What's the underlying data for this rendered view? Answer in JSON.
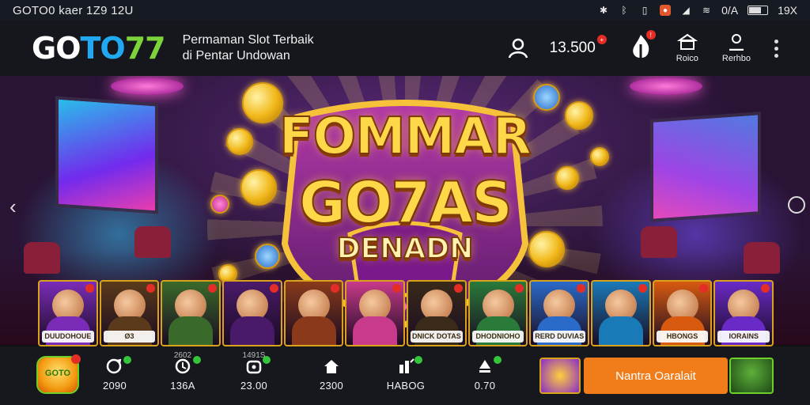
{
  "status_bar": {
    "left_text": "GOTO0 kaer 1Z9  12U",
    "right_text": "0/A",
    "right_time": "19X"
  },
  "header": {
    "logo": {
      "part1": "GO",
      "part2": "TO",
      "part3": "77"
    },
    "tagline_line1": "Permaman Slot Terbaik",
    "tagline_line2": "di Pentar Undowan",
    "balance": "13.500",
    "icon1_label": "Roico",
    "icon2_label": "Rerhbo"
  },
  "banner": {
    "title_line1": "FOMMAR",
    "title_line2": "GO7AS",
    "title_line3": "DENADN"
  },
  "games": [
    {
      "label": "DUUDOHOUE",
      "color": "#7a2cb8"
    },
    {
      "label": "Ø3",
      "color": "#5a3a1a"
    },
    {
      "label": "",
      "color": "#3a6a2a"
    },
    {
      "label": "",
      "color": "#4a1a6a"
    },
    {
      "label": "",
      "color": "#8a3a1a"
    },
    {
      "label": "",
      "color": "#c83a8a"
    },
    {
      "label": "DNICK DOTAS",
      "color": "#3a2a1a"
    },
    {
      "label": "DHODNIOHO",
      "color": "#2a7a3a"
    },
    {
      "label": "RERD DUVIAS",
      "color": "#2a6ac8"
    },
    {
      "label": "",
      "color": "#1a7ab8"
    },
    {
      "label": "HBONGS",
      "color": "#d85a10"
    },
    {
      "label": "IORAINS",
      "color": "#6a2ac8"
    }
  ],
  "bottom_nav": {
    "logo_text": "GOTO",
    "items": [
      {
        "top": "",
        "value": "2090",
        "icon": "refresh-icon"
      },
      {
        "top": "2602",
        "value": "136A",
        "icon": "history-icon"
      },
      {
        "top": "1491S",
        "value": "23.00",
        "icon": "wallet-icon"
      },
      {
        "top": "",
        "value": "2300",
        "icon": "home-icon"
      },
      {
        "top": "",
        "value": "HABOG",
        "icon": "chart-icon"
      },
      {
        "top": "",
        "value": "0.70",
        "icon": "person-icon"
      }
    ],
    "promo_button": "Nantra Oaralait"
  },
  "colors": {
    "accent_orange": "#f07d1a",
    "logo_blue": "#22a8f0",
    "logo_green": "#7cd33a",
    "gold": "#ffd84a"
  }
}
